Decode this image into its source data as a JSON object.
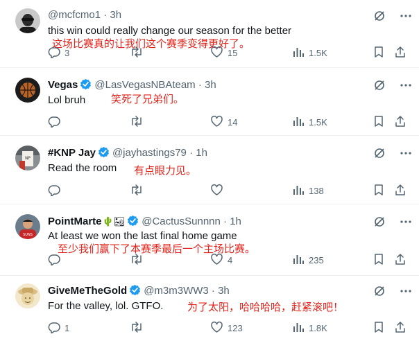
{
  "tweets": [
    {
      "display_name": "",
      "handle": "@mcfcmo1",
      "time": "3h",
      "verified": false,
      "text": "this win could really change our season for the better",
      "translation": "这场比赛真的让我们这个赛季变得更好了。",
      "replies": "3",
      "retweets": "",
      "likes": "15",
      "views": "1.5K"
    },
    {
      "display_name": "Vegas",
      "handle": "@LasVegasNBAteam",
      "time": "3h",
      "verified": true,
      "text": "Lol bruh",
      "translation": "笑死了兄弟们。",
      "replies": "",
      "retweets": "",
      "likes": "14",
      "views": "1.5K"
    },
    {
      "display_name": "#KNP Jay",
      "handle": "@jayhastings79",
      "time": "1h",
      "verified": true,
      "text": "Read the room",
      "translation": "有点眼力见。",
      "replies": "",
      "retweets": "",
      "likes": "",
      "views": "138"
    },
    {
      "display_name": "PointMarte",
      "name_emojis": "🌵🏜",
      "handle": "@CactusSunnnn",
      "time": "1h",
      "verified": true,
      "text": "At least we won the last final home game",
      "translation": "至少我们赢下了本赛季最后一个主场比赛。",
      "replies": "",
      "retweets": "",
      "likes": "4",
      "views": "235"
    },
    {
      "display_name": "GiveMeTheGold",
      "handle": "@m3m3WW3",
      "time": "3h",
      "verified": true,
      "text": "For the valley, lol. GTFO.",
      "translation": "为了太阳，哈哈哈哈，赶紧滚吧！",
      "replies": "1",
      "retweets": "",
      "likes": "123",
      "views": "1.8K"
    }
  ],
  "separator": "·",
  "colors": {
    "verified_blue": "#1d9bf0",
    "icon_gray": "#536471",
    "translation_red": "#e0241b"
  },
  "icons": [
    "grok-icon",
    "more-icon",
    "reply-icon",
    "retweet-icon",
    "like-icon",
    "views-icon",
    "bookmark-icon",
    "share-icon",
    "verified-icon"
  ]
}
